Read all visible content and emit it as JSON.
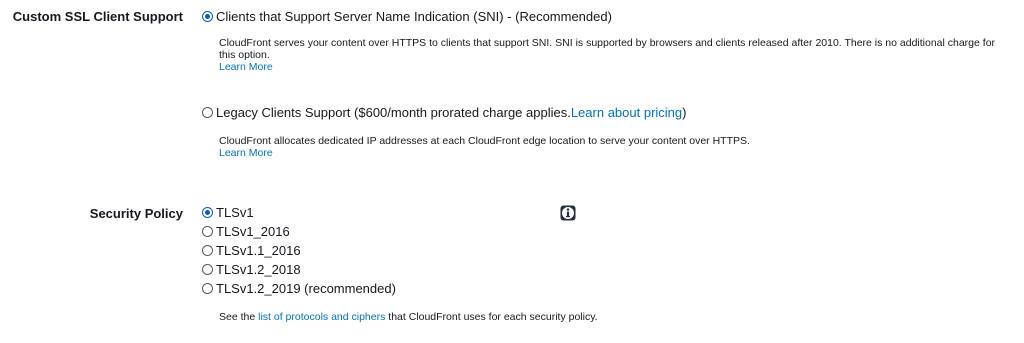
{
  "ssl_support": {
    "label": "Custom SSL Client Support",
    "options": [
      {
        "label": "Clients that Support Server Name Indication (SNI) - (Recommended)",
        "selected": true,
        "description": "CloudFront serves your content over HTTPS to clients that support SNI. SNI is supported by browsers and clients released after 2010. There is no additional charge for this option.",
        "learn_more": "Learn More"
      },
      {
        "label_prefix": "Legacy Clients Support ($600/month prorated charge applies. ",
        "link": "Learn about pricing",
        "label_suffix": ")",
        "selected": false,
        "description": "CloudFront allocates dedicated IP addresses at each CloudFront edge location to serve your content over HTTPS.",
        "learn_more": "Learn More"
      }
    ]
  },
  "security_policy": {
    "label": "Security Policy",
    "options": [
      {
        "label": "TLSv1",
        "selected": true
      },
      {
        "label": "TLSv1_2016",
        "selected": false
      },
      {
        "label": "TLSv1.1_2016",
        "selected": false
      },
      {
        "label": "TLSv1.2_2018",
        "selected": false
      },
      {
        "label": "TLSv1.2_2019 (recommended)",
        "selected": false
      }
    ],
    "footer_prefix": "See the ",
    "footer_link": "list of protocols and ciphers",
    "footer_suffix": " that CloudFront uses for each security policy.",
    "info_icon": "info-icon"
  },
  "colors": {
    "link": "#0073bb",
    "radio_selected": "#0a57d0",
    "text": "#16191f"
  }
}
